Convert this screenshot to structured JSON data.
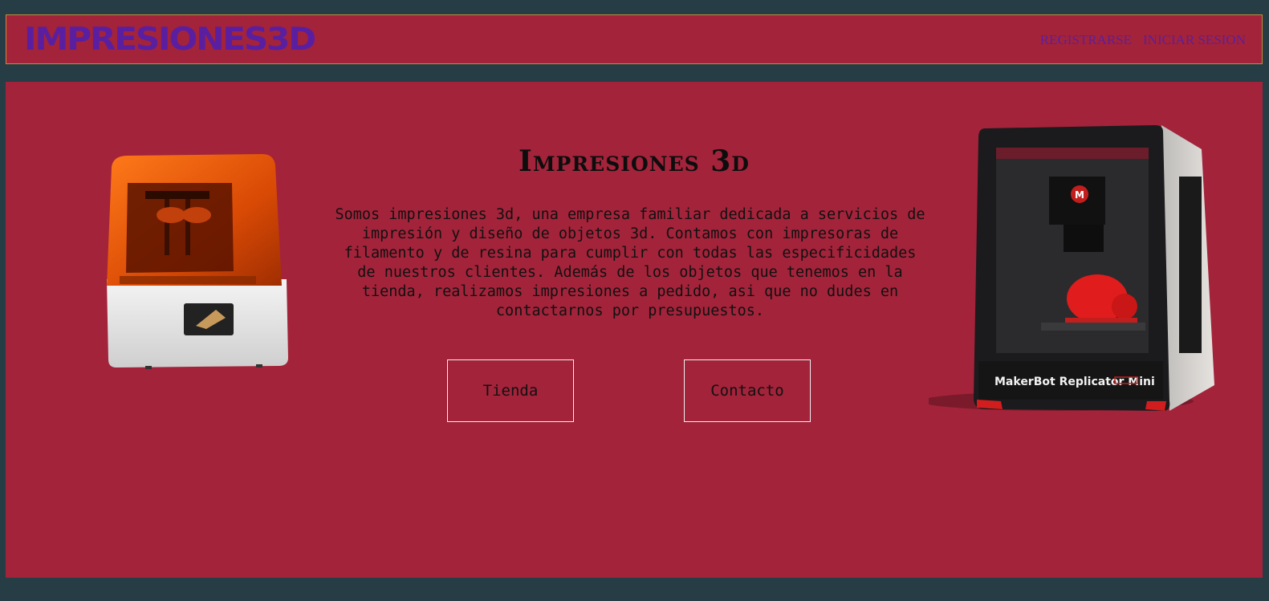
{
  "header": {
    "logo": "Impresiones3d",
    "nav": {
      "register": "REGISTRARSE",
      "login": "INICIAR SESION"
    }
  },
  "hero": {
    "title": "Impresiones 3d",
    "description": "Somos impresiones 3d, una empresa familiar dedicada a servicios de impresión y diseño de objetos 3d. Contamos con impresoras de filamento y de resina para cumplir con todas las especificidades de nuestros clientes. Además de los objetos que tenemos en la tienda, realizamos impresiones a pedido, asi que no dudes en contactarnos por presupuestos.",
    "buttons": {
      "tienda": "Tienda",
      "contacto": "Contacto"
    },
    "right_printer_label": "MakerBot Replicator Mini"
  },
  "colors": {
    "background": "#263d45",
    "panel": "#a3233a",
    "accent": "#5a1fa0",
    "button_border": "#f0f0f0"
  }
}
